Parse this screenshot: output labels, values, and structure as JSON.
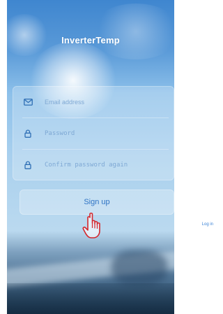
{
  "app": {
    "title": "InverterTemp"
  },
  "form": {
    "email": {
      "placeholder": "Email address",
      "value": "",
      "icon": "envelope-icon"
    },
    "password": {
      "placeholder": "Password",
      "value": "",
      "icon": "lock-icon"
    },
    "confirm": {
      "placeholder": "Confirm password again",
      "value": "",
      "icon": "lock-icon"
    }
  },
  "actions": {
    "signup_label": "Sign up",
    "login_label": "Log in"
  },
  "colors": {
    "accent": "#2f73c4",
    "icon": "#2f6fb5",
    "pointer": "#d4262c"
  }
}
